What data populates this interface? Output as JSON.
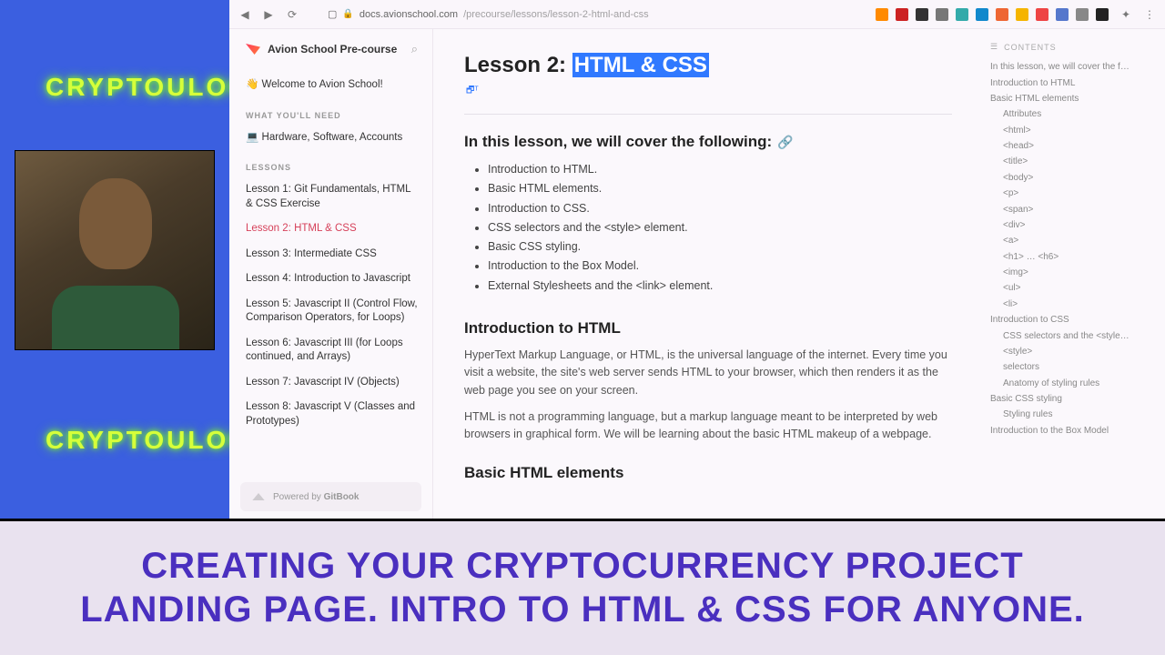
{
  "leftcol": {
    "brand": "CRYPTOULOG"
  },
  "toolbar": {
    "url_host": "docs.avionschool.com",
    "url_path": "/precourse/lessons/lesson-2-html-and-css",
    "ext_colors": [
      "#ff8a00",
      "#c22",
      "#333",
      "#777",
      "#3aa",
      "#18c",
      "#e63",
      "#f5b400",
      "#e44",
      "#57c",
      "#888",
      "#222"
    ]
  },
  "sidebar": {
    "title": "Avion School Pre-course",
    "welcome": "Welcome to Avion School!",
    "heading1": "WHAT YOU'LL NEED",
    "need_item": "Hardware, Software, Accounts",
    "heading2": "LESSONS",
    "lessons": [
      "Lesson 1: Git Fundamentals, HTML & CSS Exercise",
      "Lesson 2: HTML & CSS",
      "Lesson 3: Intermediate CSS",
      "Lesson 4: Introduction to Javascript",
      "Lesson 5: Javascript II (Control Flow, Comparison Operators, for Loops)",
      "Lesson 6: Javascript III (for Loops continued, and Arrays)",
      "Lesson 7: Javascript IV (Objects)",
      "Lesson 8: Javascript V (Classes and Prototypes)"
    ],
    "active_index": 1,
    "footer_prefix": "Powered by ",
    "footer_brand": "GitBook"
  },
  "main": {
    "title_prefix": "Lesson 2: ",
    "title_highlight": "HTML & CSS",
    "h2_intro": "In this lesson, we will cover the following:",
    "bullets": [
      "Introduction to HTML.",
      "Basic HTML elements.",
      "Introduction to CSS.",
      "CSS selectors and the <style> element.",
      "Basic CSS styling.",
      "Introduction to the Box Model.",
      "External Stylesheets and the <link> element."
    ],
    "h2_intro_html": "Introduction to HTML",
    "para1": "HyperText Markup Language, or HTML, is the universal language of the internet. Every time you visit a website, the site's web server sends HTML to your browser, which then renders it as the web page you see on your screen.",
    "para2": "HTML is not a programming language, but a markup language meant to be interpreted by web browsers in graphical form. We will be learning about the basic HTML makeup of a webpage.",
    "h2_basic": "Basic HTML elements"
  },
  "toc": {
    "heading": "CONTENTS",
    "items": [
      {
        "t": "In this lesson, we will cover the f…",
        "l": 1
      },
      {
        "t": "Introduction to HTML",
        "l": 1
      },
      {
        "t": "Basic HTML elements",
        "l": 1
      },
      {
        "t": "Attributes",
        "l": 2
      },
      {
        "t": "<html>",
        "l": 2
      },
      {
        "t": "<head>",
        "l": 2
      },
      {
        "t": "<title>",
        "l": 2
      },
      {
        "t": "<body>",
        "l": 2
      },
      {
        "t": "<p>",
        "l": 2
      },
      {
        "t": "<span>",
        "l": 2
      },
      {
        "t": "<div>",
        "l": 2
      },
      {
        "t": "<a>",
        "l": 2
      },
      {
        "t": "<h1> … <h6>",
        "l": 2
      },
      {
        "t": "<img>",
        "l": 2
      },
      {
        "t": "<ul>",
        "l": 2
      },
      {
        "t": "<li>",
        "l": 2
      },
      {
        "t": "Introduction to CSS",
        "l": 1
      },
      {
        "t": "CSS selectors and the <style…",
        "l": 2
      },
      {
        "t": "<style>",
        "l": 2
      },
      {
        "t": "selectors",
        "l": 2
      },
      {
        "t": "Anatomy of styling rules",
        "l": 2
      },
      {
        "t": "Basic CSS styling",
        "l": 1
      },
      {
        "t": "Styling rules",
        "l": 2
      },
      {
        "t": "Introduction to the Box Model",
        "l": 1
      }
    ]
  },
  "banner": {
    "line1": "CREATING YOUR CRYPTOCURRENCY PROJECT",
    "line2": "LANDING PAGE. INTRO TO HTML & CSS FOR ANYONE."
  }
}
